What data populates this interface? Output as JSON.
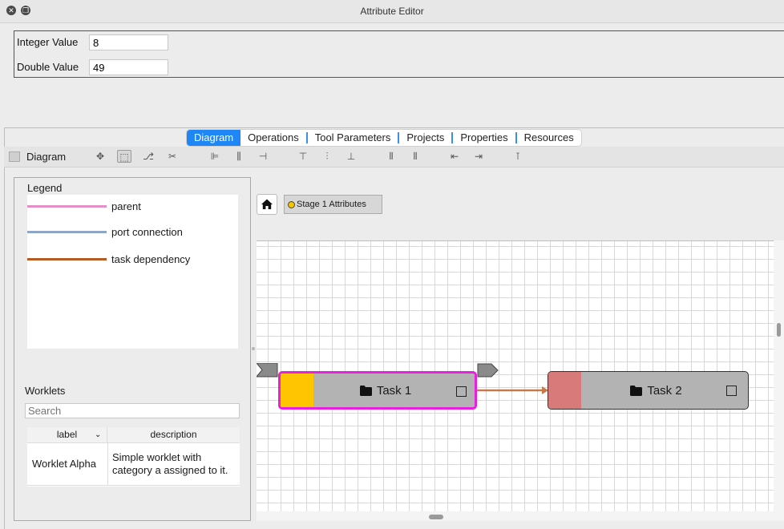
{
  "window": {
    "title": "Attribute Editor"
  },
  "attributes": [
    {
      "label": "Integer Value",
      "value": "8"
    },
    {
      "label": "Double Value",
      "value": "49"
    }
  ],
  "tabs": [
    "Diagram",
    "Operations",
    "Tool Parameters",
    "Projects",
    "Properties",
    "Resources"
  ],
  "active_tab": "Diagram",
  "toolbar": {
    "title": "Diagram"
  },
  "legend": {
    "title": "Legend",
    "items": [
      {
        "label": "parent",
        "color": "#e48fc6"
      },
      {
        "label": "port connection",
        "color": "#8ea5c8"
      },
      {
        "label": "task dependency",
        "color": "#b45a24"
      }
    ]
  },
  "worklets": {
    "title": "Worklets",
    "search_placeholder": "Search",
    "columns": [
      "label",
      "description"
    ],
    "rows": [
      {
        "label": "Worklet Alpha",
        "description_line1": "Simple worklet with",
        "description_line2": "category a assigned to it."
      }
    ]
  },
  "canvas": {
    "stage_label": "Stage 1 Attributes",
    "stage_color": "#f5c400",
    "tasks": [
      {
        "label": "Task 1",
        "status_color": "#ffc600",
        "border_color": "#e81fe0",
        "selected": true
      },
      {
        "label": "Task 2",
        "status_color": "#d97a7a",
        "border_color": "#333333",
        "selected": false
      }
    ],
    "edge_color": "#c57a4c"
  },
  "icons": {
    "close": "close-icon",
    "restore": "restore-icon",
    "home": "home-icon",
    "folder": "folder-icon",
    "chevron": "chevron-down-icon"
  }
}
